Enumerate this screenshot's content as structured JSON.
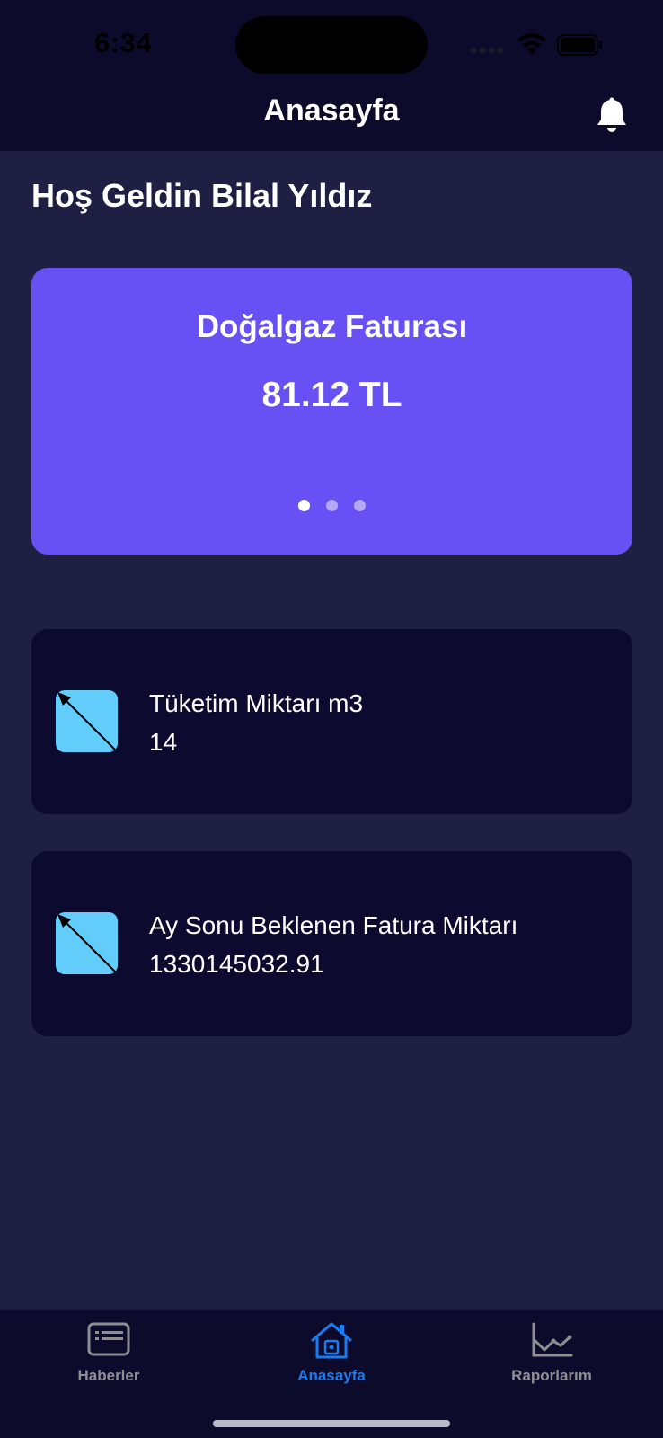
{
  "status_bar": {
    "time": "6:34"
  },
  "header": {
    "title": "Anasayfa"
  },
  "greeting": "Hoş Geldin Bilal Yıldız",
  "bill_card": {
    "title": "Doğalgaz Faturası",
    "amount": "81.12 TL",
    "pages": 3,
    "active_page": 0
  },
  "cards": [
    {
      "label": "Tüketim Miktarı m3",
      "value": "14",
      "icon": "broken-image-icon"
    },
    {
      "label": "Ay Sonu Beklenen Fatura Miktarı",
      "value": "1330145032.91",
      "icon": "broken-image-icon"
    }
  ],
  "tabs": [
    {
      "label": "Haberler",
      "icon": "news-icon",
      "active": false
    },
    {
      "label": "Anasayfa",
      "icon": "home-icon",
      "active": true
    },
    {
      "label": "Raporlarım",
      "icon": "chart-icon",
      "active": false
    }
  ],
  "colors": {
    "background": "#1e1f42",
    "bar": "#0c0b2b",
    "card": "#0c0b2f",
    "accent": "#6851f4",
    "tab_active": "#1a7cf0",
    "icon_tile": "#62cdfa"
  }
}
